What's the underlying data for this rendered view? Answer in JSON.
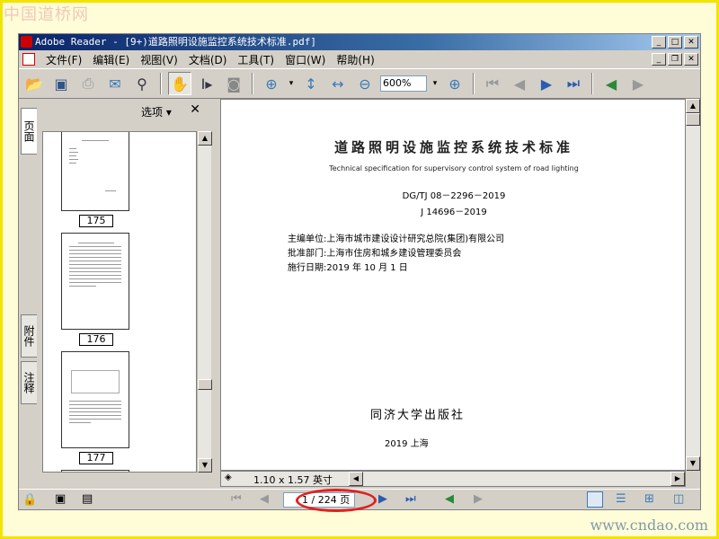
{
  "watermark": {
    "top": "中国道桥网",
    "bottom": "www.cndao.com"
  },
  "window": {
    "title": "Adobe Reader - [9+)道路照明设施监控系统技术标准.pdf]"
  },
  "menu": [
    "文件(F)",
    "编辑(E)",
    "视图(V)",
    "文档(D)",
    "工具(T)",
    "窗口(W)",
    "帮助(H)"
  ],
  "toolbar": {
    "zoom_value": "600%"
  },
  "left_tabs": [
    "页面",
    "附件",
    "注释"
  ],
  "panel": {
    "options_label": "选项 ▾",
    "close_label": "✕",
    "page_numbers": [
      "175",
      "176",
      "177"
    ]
  },
  "document": {
    "title_cn": "道路照明设施监控系统技术标准",
    "title_en": "Technical specification for supervisory control system of road lighting",
    "code1": "DG/TJ 08－2296－2019",
    "code2": "J 14696－2019",
    "info1": "主编单位:上海市城市建设设计研究总院(集团)有限公司",
    "info2": "批准部门:上海市住房和城乡建设管理委员会",
    "info3": "施行日期:2019 年 10 月 1 日",
    "publisher": "同济大学出版社",
    "place": "2019   上海"
  },
  "status": {
    "page_size": "1.10 x 1.57 英寸",
    "page_indicator": "1 / 224 页"
  },
  "colors": {
    "titlebar": "#0a246a",
    "frame": "#f2e400",
    "highlight_circle": "#e02020"
  }
}
